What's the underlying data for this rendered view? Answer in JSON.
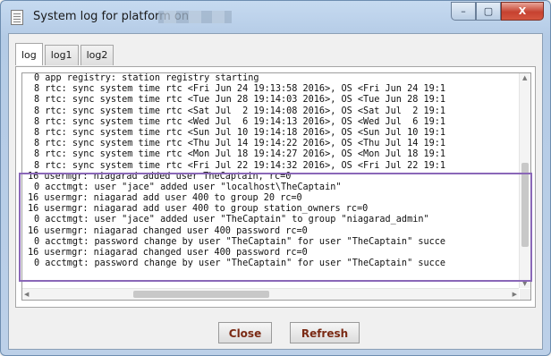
{
  "window": {
    "title": "System log for platform on",
    "controls": {
      "minimize": "–",
      "maximize": "▢",
      "close": "X"
    }
  },
  "tabs": [
    {
      "label": "log",
      "active": true
    },
    {
      "label": "log1",
      "active": false
    },
    {
      "label": "log2",
      "active": false
    }
  ],
  "log_lines": [
    "0 app registry: station registry starting",
    "8 rtc: sync system time rtc <Fri Jun 24 19:13:58 2016>, OS <Fri Jun 24 19:1",
    "8 rtc: sync system time rtc <Tue Jun 28 19:14:03 2016>, OS <Tue Jun 28 19:1",
    "8 rtc: sync system time rtc <Sat Jul  2 19:14:08 2016>, OS <Sat Jul  2 19:1",
    "8 rtc: sync system time rtc <Wed Jul  6 19:14:13 2016>, OS <Wed Jul  6 19:1",
    "8 rtc: sync system time rtc <Sun Jul 10 19:14:18 2016>, OS <Sun Jul 10 19:1",
    "8 rtc: sync system time rtc <Thu Jul 14 19:14:22 2016>, OS <Thu Jul 14 19:1",
    "8 rtc: sync system time rtc <Mon Jul 18 19:14:27 2016>, OS <Mon Jul 18 19:1",
    "8 rtc: sync system time rtc <Fri Jul 22 19:14:32 2016>, OS <Fri Jul 22 19:1",
    "16 usermgr: niagarad added user TheCaptain, rc=0",
    "0 acctmgt: user \"jace\" added user \"localhost\\TheCaptain\"",
    "16 usermgr: niagarad add user 400 to group 20 rc=0",
    "16 usermgr: niagarad add user 400 to group station_owners rc=0",
    "0 acctmgt: user \"jace\" added user \"TheCaptain\" to group \"niagarad_admin\"",
    "16 usermgr: niagarad changed user 400 password rc=0",
    "0 acctmgt: password change by user \"TheCaptain\" for user \"TheCaptain\" succe",
    "16 usermgr: niagarad changed user 400 password rc=0",
    "0 acctmgt: password change by user \"TheCaptain\" for user \"TheCaptain\" succe"
  ],
  "buttons": {
    "close": "Close",
    "refresh": "Refresh"
  },
  "colors": {
    "highlight_border": "#8a67b8",
    "button_text": "#7a2a14",
    "title_bar": "#b9cee8"
  },
  "icons": {
    "window": "document-icon"
  }
}
